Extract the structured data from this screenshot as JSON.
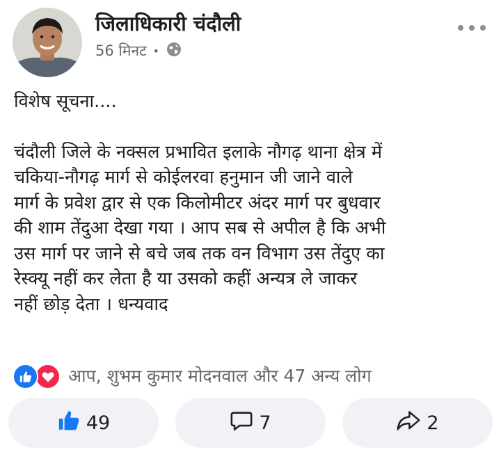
{
  "post": {
    "page_name": "जिलाधिकारी चंदौली",
    "time": "56 मिनट",
    "privacy_icon": "globe-icon",
    "heading": "विशेष सूचना....",
    "body_lines": [
      "चंदौली जिले के नक्सल प्रभावित इलाके नौगढ़ थाना क्षेत्र में",
      "चकिया-नौगढ़ मार्ग से कोईलरवा हनुमान जी जाने वाले",
      "मार्ग के प्रवेश द्वार से एक किलोमीटर अंदर मार्ग पर बुधवार",
      "की शाम तेंदुआ देखा गया । आप सब से अपील है कि अभी",
      "उस मार्ग पर जाने से बचे जब तक वन विभाग उस तेंदुए का",
      "रेस्क्यू नहीं कर लेता है या उसको कहीं अन्यत्र ले जाकर",
      "नहीं छोड़ देता । धन्यवाद"
    ]
  },
  "reactions": {
    "icons": [
      "like-reaction-icon",
      "love-reaction-icon"
    ],
    "summary": "आप, शुभम कुमार मोदनवाल और 47 अन्य लोग"
  },
  "actions": {
    "like_count": "49",
    "comment_count": "7",
    "share_count": "2"
  },
  "colors": {
    "like_blue": "#1877f2",
    "love_red": "#f0284a",
    "button_bg": "#f0f2f5",
    "secondary_text": "#65676b"
  }
}
